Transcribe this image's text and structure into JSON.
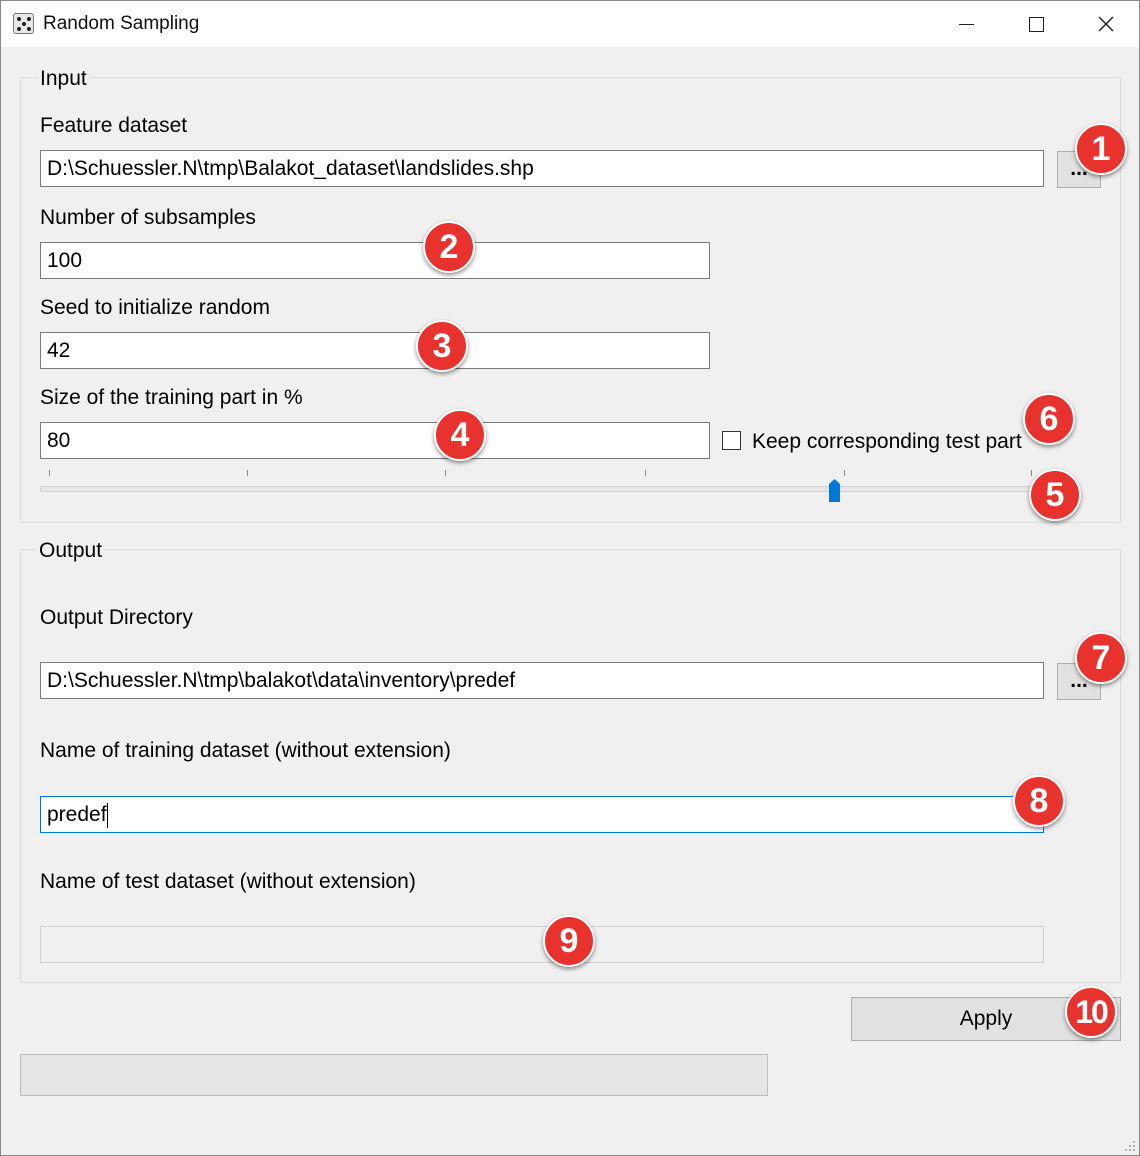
{
  "window": {
    "title": "Random Sampling",
    "minimize": "—",
    "maximize": "☐",
    "close": "✕"
  },
  "input_group": {
    "title": "Input",
    "feature_dataset_label": "Feature dataset",
    "feature_dataset_value": "D:\\Schuessler.N\\tmp\\Balakot_dataset\\landslides.shp",
    "browse_label": "...",
    "subsamples_label": "Number of subsamples",
    "subsamples_value": "100",
    "seed_label": "Seed to initialize random",
    "seed_value": "42",
    "training_size_label": "Size of the training part in %",
    "training_size_value": "80",
    "keep_test_label": "Keep corresponding test part",
    "keep_test_checked": false,
    "slider_value_fraction": 0.8
  },
  "output_group": {
    "title": "Output",
    "output_dir_label": "Output Directory",
    "output_dir_value": "D:\\Schuessler.N\\tmp\\balakot\\data\\inventory\\predef",
    "browse_label": "...",
    "training_name_label": "Name of training dataset (without extension)",
    "training_name_value": "predef",
    "test_name_label": "Name of test dataset (without extension)",
    "test_name_value": ""
  },
  "apply_label": "Apply",
  "progress_fraction": 0,
  "badges": [
    "1",
    "2",
    "3",
    "4",
    "5",
    "6",
    "7",
    "8",
    "9",
    "10"
  ],
  "colors": {
    "badge": "#e8322e",
    "slider_thumb": "#0078d7",
    "focus_border": "#0078d7"
  }
}
